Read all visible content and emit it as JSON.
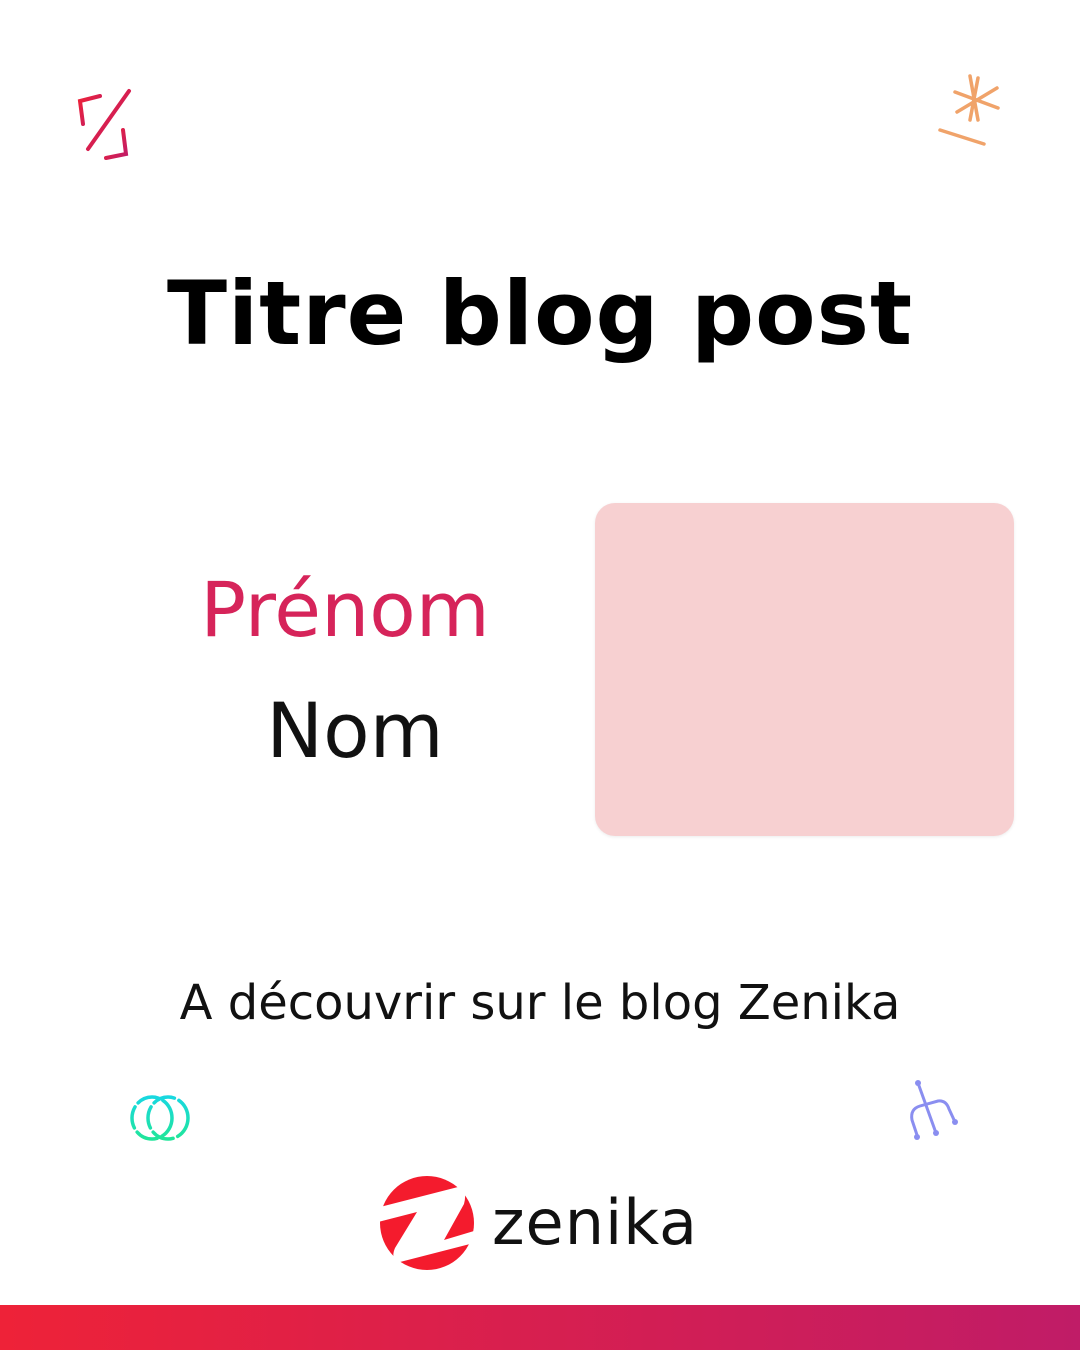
{
  "title": "Titre blog post",
  "author": {
    "first_name": "Prénom",
    "last_name": "Nom"
  },
  "tagline": "A découvrir sur le blog Zenika",
  "logo": {
    "text": "zenika",
    "icon": "zenika-z-logo-icon"
  },
  "colors": {
    "accent": "#d6245a",
    "photo_placeholder": "#f7d0d1",
    "logo_red": "#f41b2d",
    "bar_start": "#ee2238",
    "bar_end": "#c01c67"
  }
}
